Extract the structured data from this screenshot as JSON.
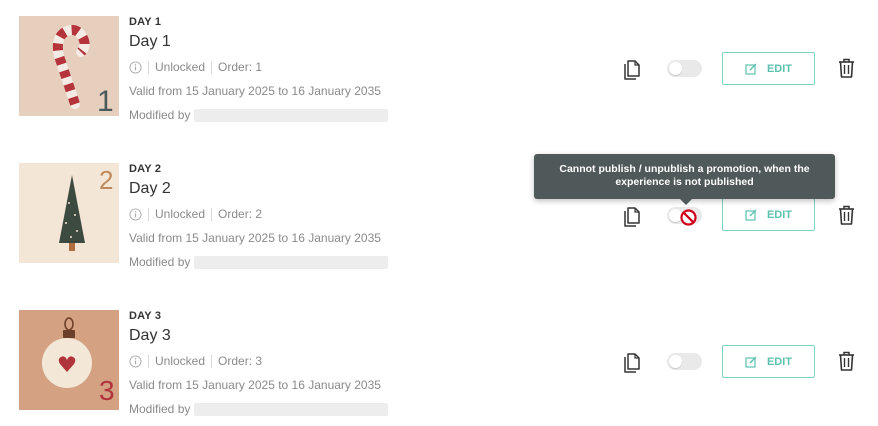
{
  "items": [
    {
      "day_tag": "DAY 1",
      "title": "Day 1",
      "status": "Unlocked",
      "order": "Order: 1",
      "valid": "Valid from 15 January 2025 to 16 January 2035",
      "modified_label": "Modified by",
      "thumb_number": "1",
      "thumb_icon": "candy-cane",
      "edit_label": "EDIT",
      "published": false
    },
    {
      "day_tag": "DAY 2",
      "title": "Day 2",
      "status": "Unlocked",
      "order": "Order: 2",
      "valid": "Valid from 15 January 2025 to 16 January 2035",
      "modified_label": "Modified by",
      "thumb_number": "2",
      "thumb_icon": "christmas-tree",
      "edit_label": "EDIT",
      "published": false
    },
    {
      "day_tag": "DAY 3",
      "title": "Day 3",
      "status": "Unlocked",
      "order": "Order: 3",
      "valid": "Valid from 15 January 2025 to 16 January 2035",
      "modified_label": "Modified by",
      "thumb_number": "3",
      "thumb_icon": "ornament-heart",
      "edit_label": "EDIT",
      "published": false
    }
  ],
  "tooltip": {
    "line1": "Cannot publish / unpublish a promotion, when the",
    "line2": "experience is not published"
  },
  "colors": {
    "accent": "#5cc1af",
    "tooltip_bg": "#50595a",
    "no_entry": "#d0021b"
  }
}
